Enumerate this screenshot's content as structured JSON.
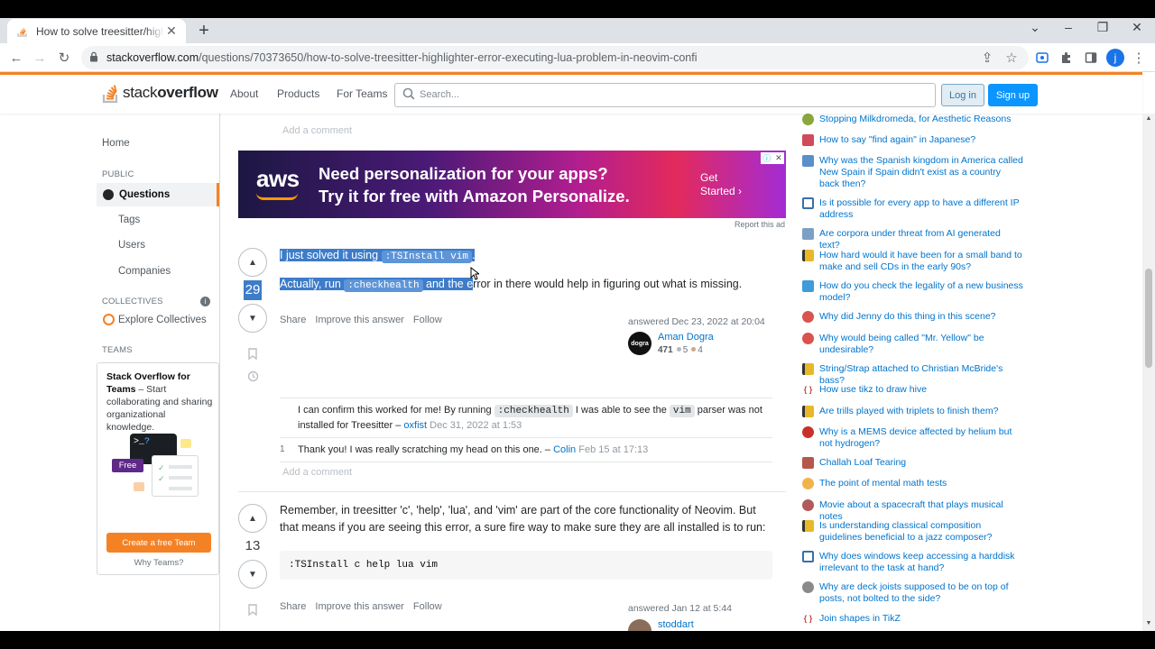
{
  "browser": {
    "tab_title": "How to solve treesitter/highlighter error executing lua problem in neovim",
    "url_host": "stackoverflow.com",
    "url_path": "/questions/70373650/how-to-solve-treesitter-highlighter-error-executing-lua-problem-in-neovim-confi",
    "profile_initial": "j"
  },
  "header": {
    "logo_light": "stack",
    "logo_bold": "overflow",
    "nav": [
      "About",
      "Products",
      "For Teams"
    ],
    "search_placeholder": "Search...",
    "login": "Log in",
    "signup": "Sign up"
  },
  "leftnav": {
    "home": "Home",
    "public": "PUBLIC",
    "questions": "Questions",
    "tags": "Tags",
    "users": "Users",
    "companies": "Companies",
    "collectives": "COLLECTIVES",
    "explore_collectives": "Explore Collectives",
    "teams": "TEAMS",
    "teams_title": "Stack Overflow for Teams",
    "teams_desc": " – Start collaborating and sharing organizational knowledge.",
    "teams_free": "Free",
    "teams_cta": "Create a free Team",
    "teams_why": "Why Teams?"
  },
  "main": {
    "add_comment": "Add a comment",
    "ad": {
      "brand": "aws",
      "line1": "Need personalization for your apps?",
      "line2": "Try it for free with Amazon Personalize.",
      "cta": "Get Started ›",
      "report": "Report this ad"
    },
    "answer1": {
      "score": "29",
      "text1_a": "I just solved it using ",
      "text1_code": ":TSInstall vim",
      "text1_b": ".",
      "text2_a": "Actually, run ",
      "text2_code": ":checkhealth",
      "text2_b": " and the e",
      "text2_c": "rror in there would help in figuring out what is missing.",
      "menu": [
        "Share",
        "Improve this answer",
        "Follow"
      ],
      "answered": "answered Dec 23, 2022 at 20:04",
      "user": "Aman Dogra",
      "avatar_text": "dogra",
      "rep": "471",
      "silver": "5",
      "bronze": "4",
      "comments": [
        {
          "score": "",
          "text_a": "I can confirm this worked for me! By running ",
          "code1": ":checkhealth",
          "text_b": " I was able to see the ",
          "code2": "vim",
          "text_c": " parser was not installed for Treesitter – ",
          "user": "oxfist",
          "date": "Dec 31, 2022 at 1:53"
        },
        {
          "score": "1",
          "text_a": "Thank you! I was really scratching my head on this one. – ",
          "user": "Colin",
          "date": "Feb 15 at 17:13"
        }
      ]
    },
    "answer2": {
      "score": "13",
      "text": "Remember, in treesitter 'c', 'help', 'lua', and 'vim' are part of the core functionality of Neovim. But that means if you are seeing this error, a sure fire way to make sure they are all installed is to run:",
      "code": ":TSInstall c help lua vim",
      "menu": [
        "Share",
        "Improve this answer",
        "Follow"
      ],
      "answered": "answered Jan 12 at 5:44",
      "user": "stoddart"
    }
  },
  "hot_questions": [
    {
      "title": "Stopping Milkdromeda, for Aesthetic Reasons",
      "color": "#8aa63c"
    },
    {
      "title": "How to say \"find again\" in Japanese?",
      "color": "#d04b5b"
    },
    {
      "title": "Why was the Spanish kingdom in America called New Spain if Spain didn't exist as a country back then?",
      "color": "#5a8fc9"
    },
    {
      "title": "Is it possible for every app to have a different IP address",
      "color": "#3a6fa8"
    },
    {
      "title": "Are corpora under threat from AI generated text?",
      "color": "#7aa0c4"
    },
    {
      "title": "How hard would it have been for a small band to make and sell CDs in the early 90s?",
      "color": "#e8b82a"
    },
    {
      "title": "How do you check the legality of a new business model?",
      "color": "#3f9bd9"
    },
    {
      "title": "Why did Jenny do this thing in this scene?",
      "color": "#d9534f"
    },
    {
      "title": "Why would being called \"Mr. Yellow\" be undesirable?",
      "color": "#d9534f"
    },
    {
      "title": "String/Strap attached to Christian McBride's bass?",
      "color": "#e8b82a"
    },
    {
      "title": "How use tikz to draw hive",
      "color": "#c24a4a"
    },
    {
      "title": "Are trills played with triplets to finish them?",
      "color": "#e8b82a"
    },
    {
      "title": "Why is a MEMS device affected by helium but not hydrogen?",
      "color": "#c9302c"
    },
    {
      "title": "Challah Loaf Tearing",
      "color": "#b5584a"
    },
    {
      "title": "The point of mental math tests",
      "color": "#f0b44c"
    },
    {
      "title": "Movie about a spacecraft that plays musical notes",
      "color": "#b25a5a"
    },
    {
      "title": "Is understanding classical composition guidelines beneficial to a jazz composer?",
      "color": "#e8b82a"
    },
    {
      "title": "Why does windows keep accessing a harddisk irrelevant to the task at hand?",
      "color": "#3a6fa8"
    },
    {
      "title": "Why are deck joists supposed to be on top of posts, not bolted to the side?",
      "color": "#8a8a8a"
    },
    {
      "title": "Join shapes in TikZ",
      "color": "#c24a4a"
    }
  ]
}
